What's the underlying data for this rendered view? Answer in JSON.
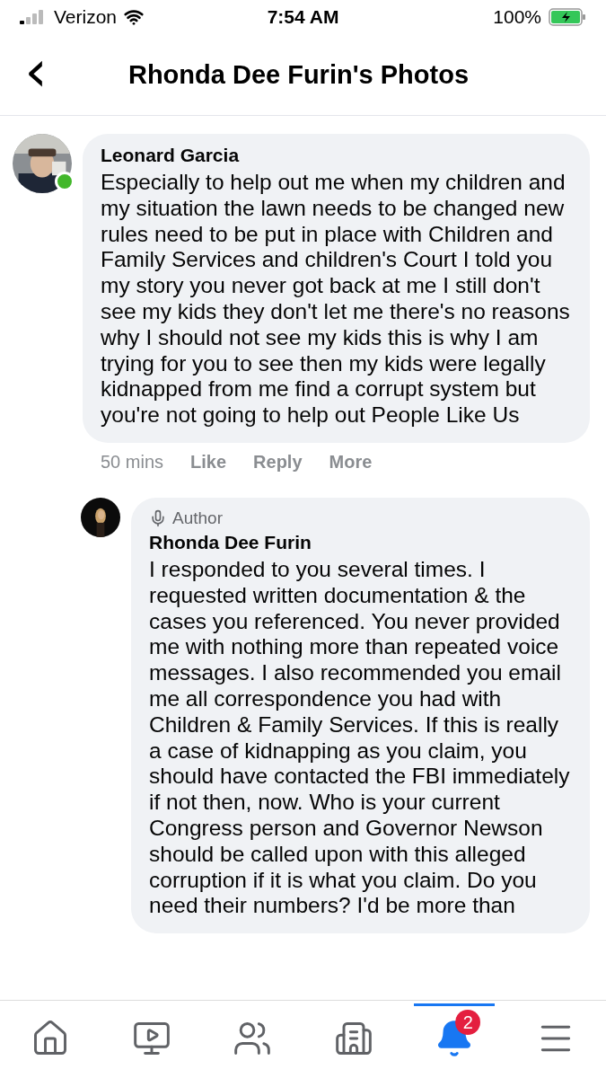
{
  "status_bar": {
    "carrier": "Verizon",
    "time": "7:54 AM",
    "battery": "100%"
  },
  "header": {
    "back": "‹",
    "title": "Rhonda Dee Furin's Photos"
  },
  "comments": [
    {
      "author": "Leonard Garcia",
      "online": true,
      "author_badge": false,
      "text": "Especially to help out me when my children and my situation the lawn needs to be changed new rules need to be put in place with Children and Family Services and children's Court I told you my story you never got back at me I still don't see my kids they don't let me there's no reasons why I should not see my kids this is why I am trying for you to see then my kids were legally kidnapped from me find a corrupt system but you're not going to help out People Like Us",
      "time": "50 mins",
      "actions": [
        "Like",
        "Reply",
        "More"
      ],
      "reply": false
    },
    {
      "author": "Rhonda Dee Furin",
      "online": false,
      "author_badge": true,
      "badge_label": "Author",
      "text": "I responded to you several times. I requested written documentation & the cases you referenced. You never provided me with nothing more than repeated voice messages. I also recommended you email me all correspondence you had with Children & Family Services. If this is really a case of kidnapping as you claim, you should have contacted the FBI immediately if not then, now. Who is your current Congress person and Governor Newson should be called upon with this alleged corruption if it is what you claim. Do you need their numbers? I'd be more than",
      "reply": true
    }
  ],
  "nav": [
    {
      "kind": "home",
      "selected": false
    },
    {
      "kind": "video",
      "selected": false
    },
    {
      "kind": "groups",
      "selected": false
    },
    {
      "kind": "pages",
      "selected": false
    },
    {
      "kind": "notifications",
      "selected": true,
      "badge": "2"
    },
    {
      "kind": "menu",
      "selected": false
    }
  ]
}
